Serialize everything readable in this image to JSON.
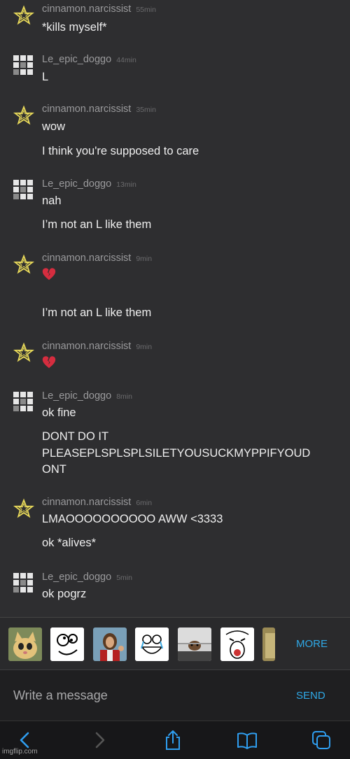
{
  "messages": [
    {
      "author": "cinnamon.narcissist",
      "time": "55min",
      "lines": [
        "*kills myself*"
      ]
    },
    {
      "author": "Le_epic_doggo",
      "time": "44min",
      "lines": [
        "L"
      ]
    },
    {
      "author": "cinnamon.narcissist",
      "time": "35min",
      "lines": [
        "wow",
        "I think you're supposed to care"
      ]
    },
    {
      "author": "Le_epic_doggo",
      "time": "13min",
      "lines": [
        "nah",
        "I’m not an L like them"
      ]
    },
    {
      "author": "cinnamon.narcissist",
      "time": "9min",
      "emoji": "broken-heart-emoji",
      "lines": [
        "I’m not an L like them"
      ]
    },
    {
      "author": "cinnamon.narcissist",
      "time": "9min",
      "emoji": "broken-heart-emoji",
      "lines": []
    },
    {
      "author": "Le_epic_doggo",
      "time": "8min",
      "lines": [
        "ok fine",
        "DONT DO IT",
        "PLEASEPLSPLSPLSILETYOUSUCKMYPPIFYOUD",
        "ONT"
      ]
    },
    {
      "author": "cinnamon.narcissist",
      "time": "6min",
      "lines": [
        "LMAOOOOOOOOOO AWW <3333",
        "ok *alives*"
      ]
    },
    {
      "author": "Le_epic_doggo",
      "time": "5min",
      "lines": [
        "ok pogrz"
      ]
    }
  ],
  "stickers": [
    "cat-sticker",
    "derp-sticker",
    "jesus-sticker",
    "rage-face-sticker",
    "ceiling-cat-sticker",
    "lol-face-sticker",
    "partial-sticker"
  ],
  "stickers_more_label": "MORE",
  "composer": {
    "placeholder": "Write a message",
    "send_label": "SEND"
  },
  "toolbar": {
    "icons": [
      "back-icon",
      "forward-icon",
      "share-icon",
      "bookmarks-icon",
      "tabs-icon"
    ]
  },
  "watermark": "imgflip.com",
  "colors": {
    "accent": "#2fa8e6",
    "background": "#2e2e30",
    "star_avatar": "#e8d95a"
  }
}
